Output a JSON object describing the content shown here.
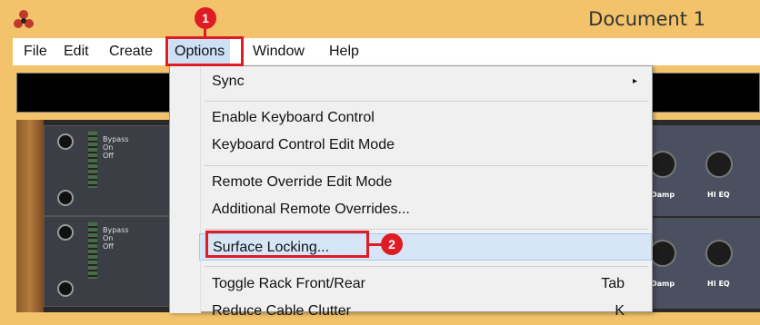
{
  "window": {
    "title": "Document 1"
  },
  "menubar": {
    "items": [
      {
        "label": "File"
      },
      {
        "label": "Edit"
      },
      {
        "label": "Create"
      },
      {
        "label": "Options"
      },
      {
        "label": "Window"
      },
      {
        "label": "Help"
      }
    ]
  },
  "options_menu": {
    "items": [
      {
        "label": "Sync",
        "submenu_glyph": "▸"
      },
      {
        "label": "Enable Keyboard Control"
      },
      {
        "label": "Keyboard Control Edit Mode"
      },
      {
        "label": "Remote Override Edit Mode"
      },
      {
        "label": "Additional Remote Overrides..."
      },
      {
        "label": "Surface Locking..."
      },
      {
        "label": "Toggle Rack Front/Rear",
        "shortcut": "Tab"
      },
      {
        "label": "Reduce Cable Clutter",
        "shortcut": "K"
      }
    ]
  },
  "rack": {
    "bypass_labels": [
      "Bypass",
      "On",
      "Off"
    ],
    "knob_labels": [
      "Damp",
      "HI EQ"
    ]
  },
  "annotations": {
    "badge_1": "1",
    "badge_2": "2",
    "color": "#e01b24"
  }
}
